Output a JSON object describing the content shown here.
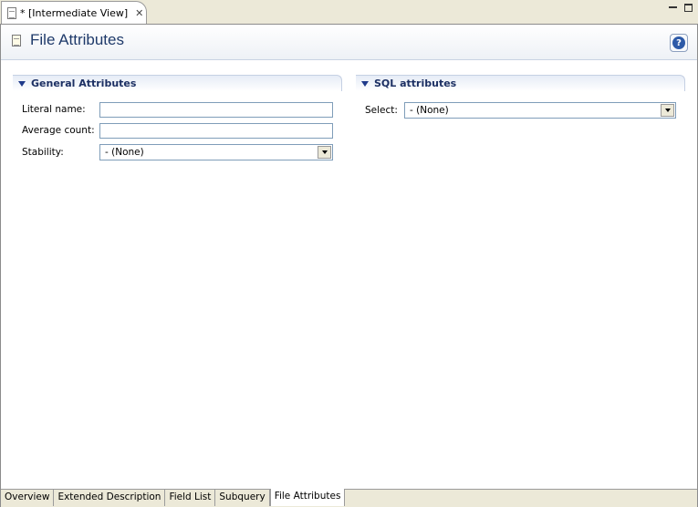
{
  "editor_tab": {
    "title": "* [Intermediate View]"
  },
  "header": {
    "title": "File Attributes"
  },
  "general": {
    "title": "General Attributes",
    "literal_name_label": "Literal name:",
    "literal_name_value": "",
    "average_count_label": "Average count:",
    "average_count_value": "",
    "stability_label": "Stability:",
    "stability_value": "- (None)"
  },
  "sql": {
    "title": "SQL attributes",
    "select_label": "Select:",
    "select_value": "- (None)"
  },
  "bottom_tabs": [
    "Overview",
    "Extended Description",
    "Field List",
    "Subquery",
    "File Attributes"
  ],
  "active_tab": "File Attributes",
  "colors": {
    "header_title": "#1f3a6a",
    "section_title": "#1c2f63",
    "tab_bar": "#ece9d8"
  }
}
